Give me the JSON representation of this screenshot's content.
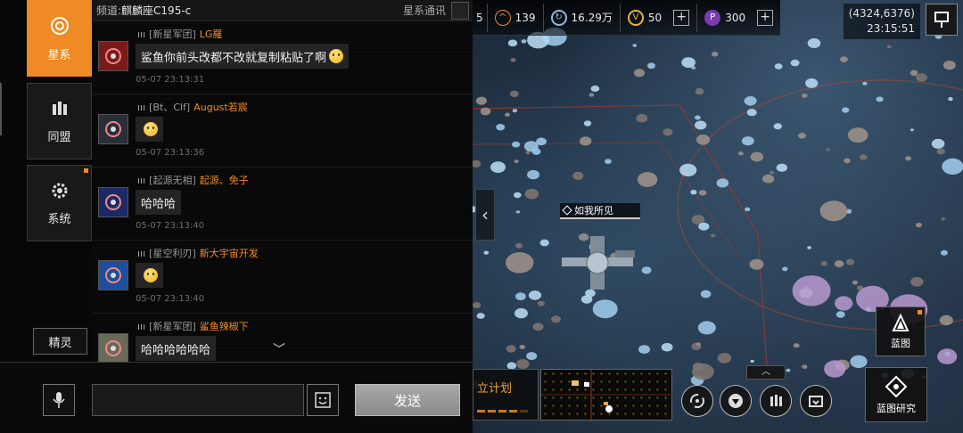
{
  "chat": {
    "side_tabs": [
      {
        "label": "星系",
        "icon": "star-system-icon",
        "active": true
      },
      {
        "label": "同盟",
        "icon": "alliance-icon",
        "active": false
      },
      {
        "label": "系统",
        "icon": "gear-icon",
        "active": false
      }
    ],
    "spirit_label": "精灵",
    "channel_prefix": "频道:",
    "channel_name": "麒麟座C195-c",
    "channel_type": "星系通讯",
    "messages": [
      {
        "alliance": "[新星军团]",
        "user": "LG羅",
        "text": "鲨鱼你前头改都不改就复制粘贴了啊",
        "emoji": true,
        "time": "05-07 23:13:31",
        "avatar_color": "#7a1a1a"
      },
      {
        "alliance": "[Bt、Clf]",
        "user": "August若宸",
        "text": "",
        "emoji": true,
        "time": "05-07 23:13:36",
        "avatar_color": "#2a2e38"
      },
      {
        "alliance": "[起源无相]",
        "user": "起源、免子",
        "text": "哈哈哈",
        "emoji": false,
        "time": "05-07 23:13:40",
        "avatar_color": "#1b2a66"
      },
      {
        "alliance": "[星空利刃]",
        "user": "新大宇宙开发",
        "text": "",
        "emoji": true,
        "time": "05-07 23:13:40",
        "avatar_color": "#1d4f9a"
      },
      {
        "alliance": "[新星军团]",
        "user": "鲨鱼辣椒下",
        "text": "哈哈哈哈哈哈",
        "emoji": false,
        "time": "",
        "avatar_color": "#6a6a5a"
      }
    ],
    "input_placeholder": "",
    "send_label": "发送"
  },
  "hud": {
    "res_partial": "5",
    "res1": "139",
    "res2": "16.29万",
    "res3": "50",
    "res4": "300",
    "coords": "(4324,6376)",
    "clock": "23:15:51",
    "fleet_label": "如我所见",
    "blueprint_label": "蓝图",
    "blueprint_research_label": "蓝图研究",
    "plan_label": "立计划",
    "bottom_icons": [
      "galaxy-icon",
      "download-icon",
      "alliance-icon",
      "folder-icon"
    ]
  },
  "colors": {
    "accent": "#f08a24",
    "username": "#f08a24",
    "bubble": "#242424"
  }
}
